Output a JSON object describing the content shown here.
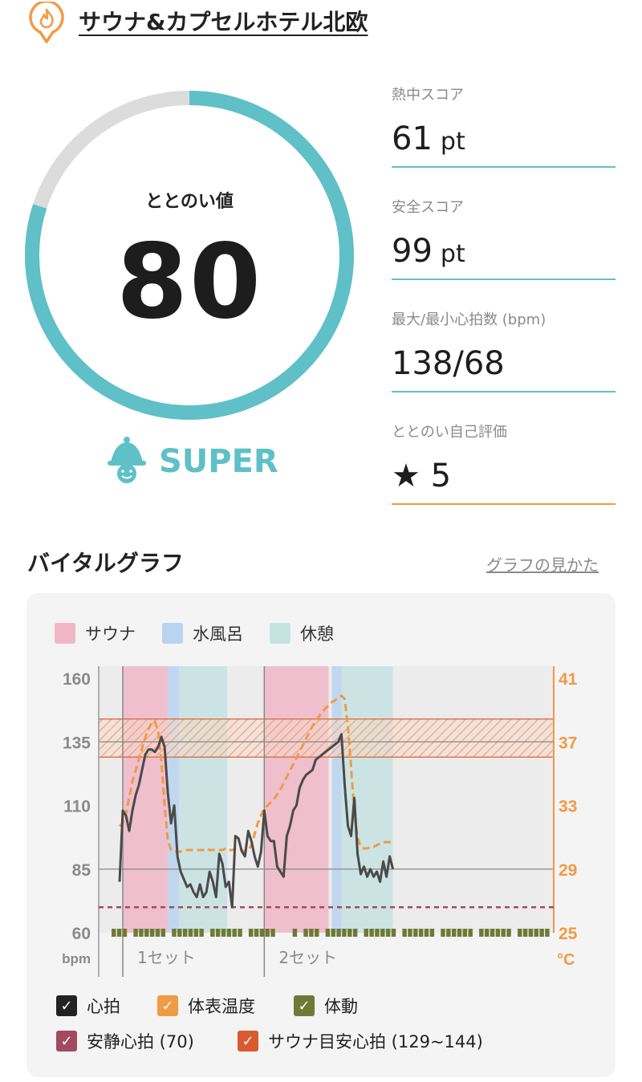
{
  "header": {
    "facility_name": "サウナ&カプセルホテル北欧"
  },
  "score": {
    "label": "ととのい値",
    "value": "80",
    "percent": 80,
    "rank": "SUPER"
  },
  "stats": [
    {
      "label": "熱中スコア",
      "value": "61",
      "unit": "pt"
    },
    {
      "label": "安全スコア",
      "value": "99",
      "unit": "pt"
    },
    {
      "label": "最大/最小心拍数 (bpm)",
      "value": "138/68",
      "unit": ""
    },
    {
      "label": "ととのい自己評価",
      "value": "★ 5",
      "unit": ""
    }
  ],
  "vital": {
    "title": "バイタルグラフ",
    "help_link": "グラフの見かた",
    "legend": [
      {
        "label": "サウナ",
        "color": "#f0b7c9"
      },
      {
        "label": "水風呂",
        "color": "#b9d3f0"
      },
      {
        "label": "休憩",
        "color": "#c6e3e2"
      }
    ],
    "checks": [
      {
        "label": "心拍",
        "color": "#222222"
      },
      {
        "label": "体表温度",
        "color": "#f19a45"
      },
      {
        "label": "体動",
        "color": "#6e7a35"
      },
      {
        "label": "安静心拍 (70)",
        "color": "#a34a62"
      },
      {
        "label": "サウナ目安心拍 (129~144)",
        "color": "#d85a2e"
      }
    ]
  },
  "chart_data": {
    "type": "line",
    "left_axis": {
      "unit": "bpm",
      "ticks": [
        "160",
        "135",
        "110",
        "85",
        "60"
      ],
      "ylim": [
        60,
        160
      ]
    },
    "right_axis": {
      "unit": "°C",
      "ticks": [
        "41",
        "37",
        "33",
        "29",
        "25"
      ],
      "ylim": [
        25,
        41
      ]
    },
    "set_labels": [
      "1セット",
      "2セット"
    ],
    "resting_hr": 70,
    "sauna_target_hr": [
      129,
      144
    ],
    "x": [
      0,
      1,
      2,
      3,
      4,
      5,
      6,
      7,
      8,
      9,
      10,
      11,
      12,
      13,
      14,
      15,
      16,
      17,
      18,
      19,
      20,
      21,
      22,
      23,
      24,
      25,
      26,
      27,
      28,
      29,
      30,
      31,
      32,
      33,
      34,
      35,
      36,
      37,
      38,
      39,
      40,
      41,
      42,
      43,
      44,
      45,
      46,
      47,
      48,
      49,
      50,
      51,
      52,
      53,
      54,
      55,
      56,
      57,
      58,
      59,
      60,
      61,
      62,
      63,
      64,
      65,
      66,
      67,
      68,
      69,
      70,
      71,
      72,
      73,
      74,
      75,
      76,
      77,
      78,
      79,
      80,
      81,
      82,
      83,
      84,
      85,
      86,
      87,
      88,
      89,
      90,
      91,
      92,
      93,
      94,
      95,
      96,
      97,
      98,
      99,
      100,
      101,
      102,
      103,
      104,
      105,
      106,
      107,
      108,
      109,
      110,
      111,
      112,
      113,
      114,
      115,
      116,
      117,
      118,
      119,
      120,
      121,
      122,
      123,
      124,
      125,
      126,
      127,
      128,
      129,
      130,
      131,
      132,
      133,
      134,
      135
    ],
    "series": [
      {
        "name": "心拍",
        "values": [
          80,
          108,
          106,
          100,
          108,
          114,
          118,
          124,
          130,
          132,
          132,
          131,
          133,
          137,
          133,
          115,
          103,
          110,
          90,
          84,
          81,
          78,
          79,
          76,
          74,
          79,
          74,
          76,
          84,
          80,
          74,
          91,
          87,
          78,
          80,
          70,
          98,
          97,
          92,
          90,
          100,
          96,
          90,
          86,
          92,
          108,
          98,
          96,
          96,
          86,
          84,
          82,
          98,
          102,
          108,
          110,
          117,
          120,
          122,
          123,
          124,
          128,
          129,
          130,
          131,
          132,
          133,
          134,
          135,
          138,
          118,
          102,
          98,
          113,
          91,
          83,
          86,
          82,
          85,
          82,
          84,
          80,
          88,
          82,
          90,
          85
        ]
      },
      {
        "name": "体表温度",
        "values": [
          31.7,
          31.9,
          32.5,
          33.5,
          34.5,
          35.2,
          35.9,
          36.6,
          37.3,
          37.8,
          38.2,
          38.3,
          37.6,
          35.8,
          33.0,
          30.8,
          30.2,
          30.1,
          30.1,
          30.1,
          30.2,
          30.2,
          30.2,
          30.2,
          30.2,
          30.2,
          30.2,
          30.3,
          30.2,
          30.2,
          30.2,
          30.2,
          30.2,
          30.3,
          30.2,
          30.2,
          30.3,
          30.3,
          30.2,
          30.1,
          30.2,
          30.5,
          31.2,
          31.9,
          32.4,
          32.8,
          33.0,
          33.2,
          33.4,
          33.7,
          34.0,
          34.4,
          34.8,
          35.2,
          35.6,
          36.0,
          36.4,
          36.8,
          37.2,
          37.6,
          38.0,
          38.3,
          38.6,
          38.9,
          39.1,
          39.3,
          39.5,
          39.6,
          39.8,
          39.9,
          39.7,
          38.0,
          35.4,
          32.5,
          31.0,
          30.4,
          30.3,
          30.3,
          30.4,
          30.4,
          30.5,
          30.6,
          30.7,
          30.7,
          30.7,
          30.7
        ]
      }
    ]
  }
}
